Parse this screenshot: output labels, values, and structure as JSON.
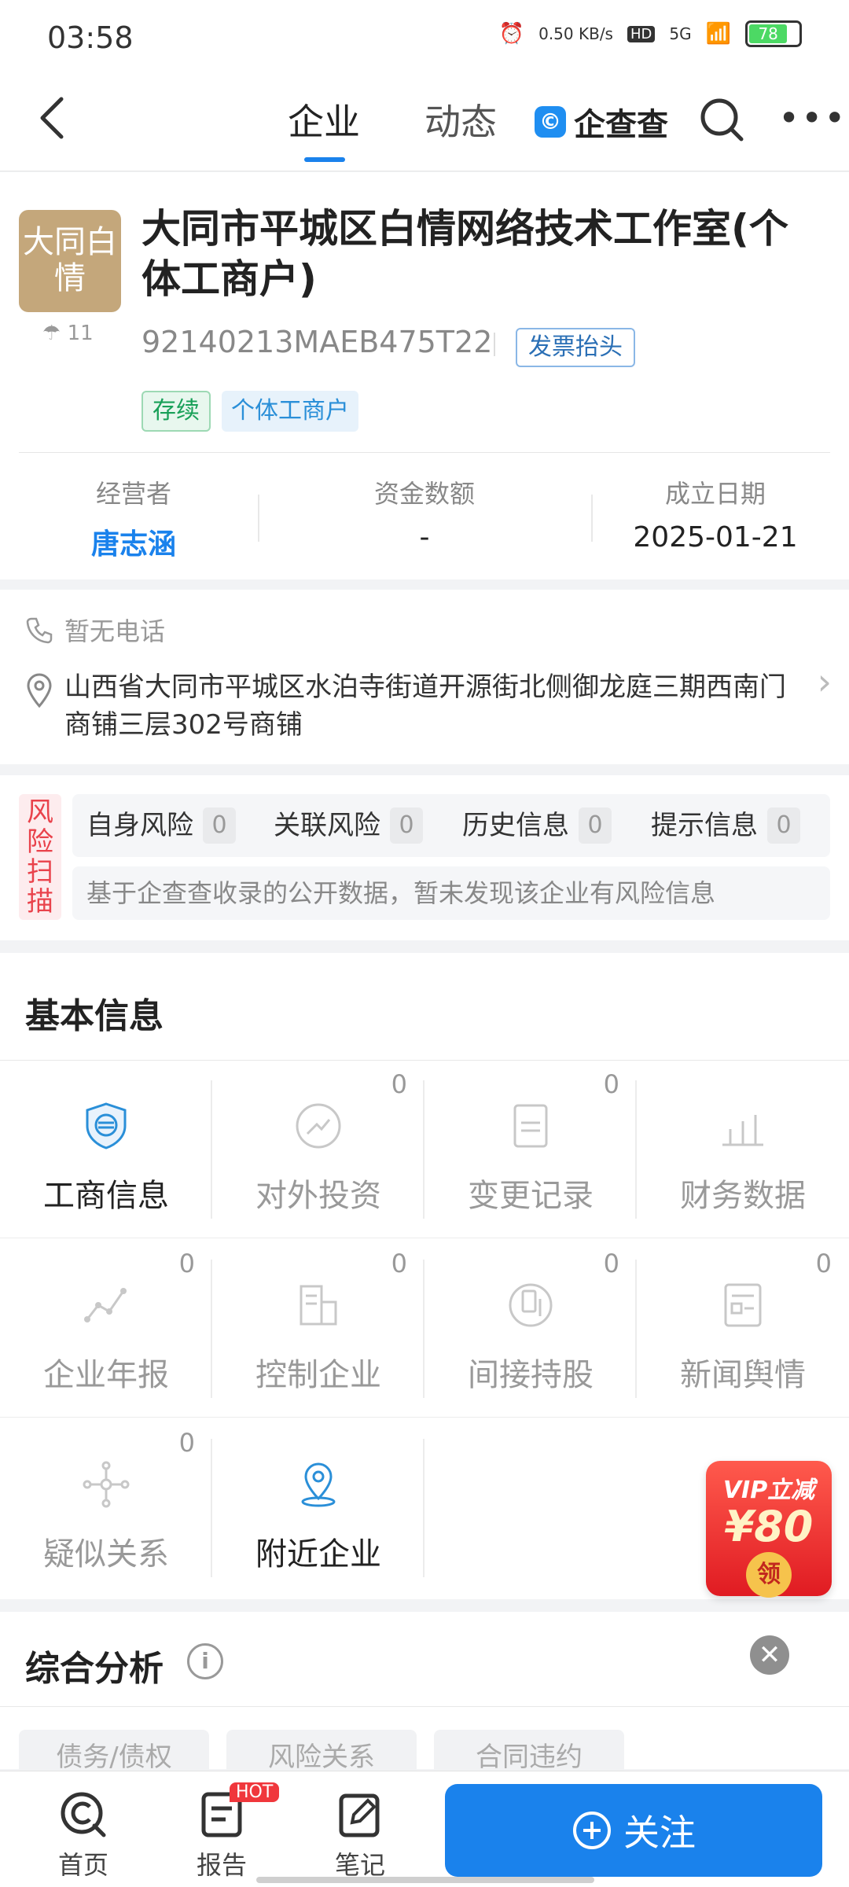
{
  "status_bar": {
    "time": "03:58",
    "speed": "0.50 KB/s",
    "hd": "HD",
    "net": "5G",
    "battery": "78"
  },
  "nav": {
    "tab_company": "企业",
    "tab_dynamic": "动态",
    "brand": "企查查"
  },
  "company": {
    "logo_text": "大同白情",
    "views": "11",
    "name": "大同市平城区白情网络技术工作室(个体工商户)",
    "credit_code": "92140213MAEB475T22",
    "invoice_label": "发票抬头",
    "tags": [
      "存续",
      "个体工商户"
    ],
    "stats": [
      {
        "label": "经营者",
        "value": "唐志涵"
      },
      {
        "label": "资金数额",
        "value": "-"
      },
      {
        "label": "成立日期",
        "value": "2025-01-21"
      }
    ]
  },
  "contact": {
    "phone": "暂无电话",
    "address": "山西省大同市平城区水泊寺街道开源街北侧御龙庭三期西南门商铺三层302号商铺"
  },
  "risk": {
    "side_label": "风险扫描",
    "items": [
      {
        "label": "自身风险",
        "count": "0"
      },
      {
        "label": "关联风险",
        "count": "0"
      },
      {
        "label": "历史信息",
        "count": "0"
      },
      {
        "label": "提示信息",
        "count": "0"
      }
    ],
    "summary": "基于企查查收录的公开数据，暂未发现该企业有风险信息"
  },
  "basic": {
    "title": "基本信息",
    "cells": [
      {
        "label": "工商信息",
        "count": "",
        "icon": "shield-icon"
      },
      {
        "label": "对外投资",
        "count": "0",
        "icon": "trend-icon"
      },
      {
        "label": "变更记录",
        "count": "0",
        "icon": "change-icon"
      },
      {
        "label": "财务数据",
        "count": "",
        "icon": "bar-icon"
      },
      {
        "label": "企业年报",
        "count": "0",
        "icon": "line-icon"
      },
      {
        "label": "控制企业",
        "count": "0",
        "icon": "building-icon"
      },
      {
        "label": "间接持股",
        "count": "0",
        "icon": "holding-icon"
      },
      {
        "label": "新闻舆情",
        "count": "0",
        "icon": "news-icon"
      },
      {
        "label": "疑似关系",
        "count": "0",
        "icon": "network-icon"
      },
      {
        "label": "附近企业",
        "count": "",
        "icon": "location-icon"
      }
    ]
  },
  "vip": {
    "line1": "VIP立减",
    "line2": "¥80",
    "coin": "领"
  },
  "analysis": {
    "title": "综合分析",
    "chips": [
      "债务/债权",
      "风险关系",
      "合同违约"
    ]
  },
  "bottom": {
    "home": "首页",
    "report": "报告",
    "hot": "HOT",
    "note": "笔记",
    "follow": "关注"
  },
  "colors": {
    "accent": "#1a82ec",
    "danger": "#e9424b",
    "success": "#18a058"
  }
}
